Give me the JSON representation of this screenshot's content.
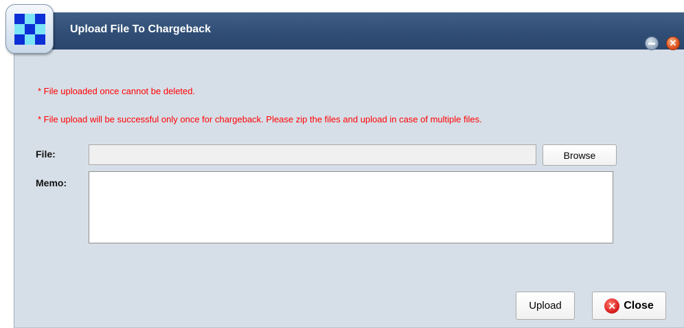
{
  "window": {
    "title": "Upload File To Chargeback",
    "minimize_icon": "minimize-icon",
    "close_icon": "close-icon",
    "close_glyph": "✕"
  },
  "logo": {
    "icon": "checkerboard-logo",
    "colors": {
      "primary": "#0c2fd6",
      "secondary": "#7ce4f7"
    }
  },
  "notices": [
    "* File uploaded once cannot be deleted.",
    "* File upload will be successful only once for chargeback.  Please zip the files and upload in case of multiple files."
  ],
  "form": {
    "file_label": "File:",
    "file_value": "",
    "browse_label": "Browse",
    "memo_label": "Memo:",
    "memo_value": ""
  },
  "actions": {
    "upload_label": "Upload",
    "close_label": "Close",
    "close_glyph": "✕"
  },
  "colors": {
    "titlebar": "#2f4d74",
    "dialog_bg": "#d6dfe8",
    "notice_text": "#ff0000"
  }
}
